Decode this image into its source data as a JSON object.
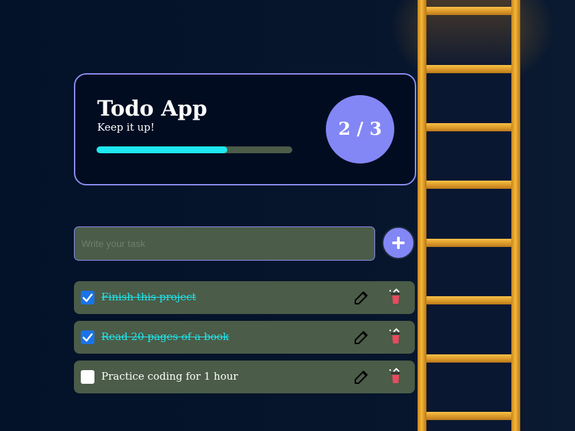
{
  "header": {
    "title": "Todo App",
    "subtitle": "Keep it up!",
    "progress": 0.667,
    "counter": "2 / 3"
  },
  "input": {
    "placeholder": "Write your task",
    "value": ""
  },
  "add_button": {
    "icon": "plus-icon"
  },
  "todos": [
    {
      "text": "Finish this project",
      "done": true
    },
    {
      "text": "Read 20 pages of a book",
      "done": true
    },
    {
      "text": "Practice coding for 1 hour",
      "done": false
    }
  ],
  "icons": {
    "edit": "edit-icon",
    "delete": "trash-icon"
  },
  "colors": {
    "accent": "#8387f5",
    "progress": "#1ee8f0",
    "panel": "#4b5c48",
    "background": "#04142b",
    "trash": "#e84a5f"
  }
}
